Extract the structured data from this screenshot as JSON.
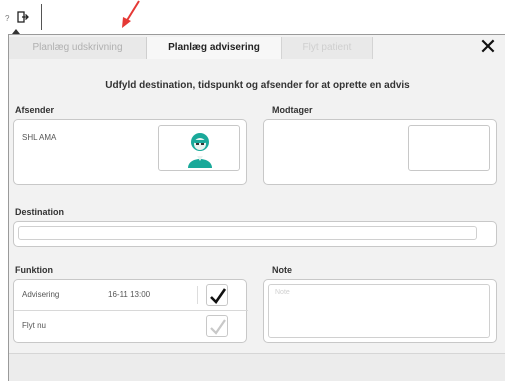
{
  "toolbar": {
    "help_glyph": "?",
    "logout_icon": "logout-icon",
    "annotation_arrow_color": "#e53935"
  },
  "dialog": {
    "tabs": [
      {
        "label": "Planlæg udskrivning",
        "state": "disabled"
      },
      {
        "label": "Planlæg advisering",
        "state": "active"
      },
      {
        "label": "Flyt patient",
        "state": "disabled"
      }
    ],
    "close_glyph": "✕",
    "instruction": "Udfyld destination, tidspunkt og afsender for at oprette en advis",
    "sender": {
      "label": "Afsender",
      "value": "SHL AMA",
      "avatar_icon": "nurse-avatar-icon",
      "avatar_color": "#1aa99a"
    },
    "receiver": {
      "label": "Modtager"
    },
    "destination": {
      "label": "Destination",
      "value": ""
    },
    "function": {
      "label": "Funktion",
      "rows": [
        {
          "label": "Advisering",
          "time": "16-11 13:00",
          "checked": true
        },
        {
          "label": "Flyt nu",
          "time": "",
          "checked": false
        }
      ]
    },
    "note": {
      "label": "Note",
      "placeholder": "Note"
    }
  }
}
